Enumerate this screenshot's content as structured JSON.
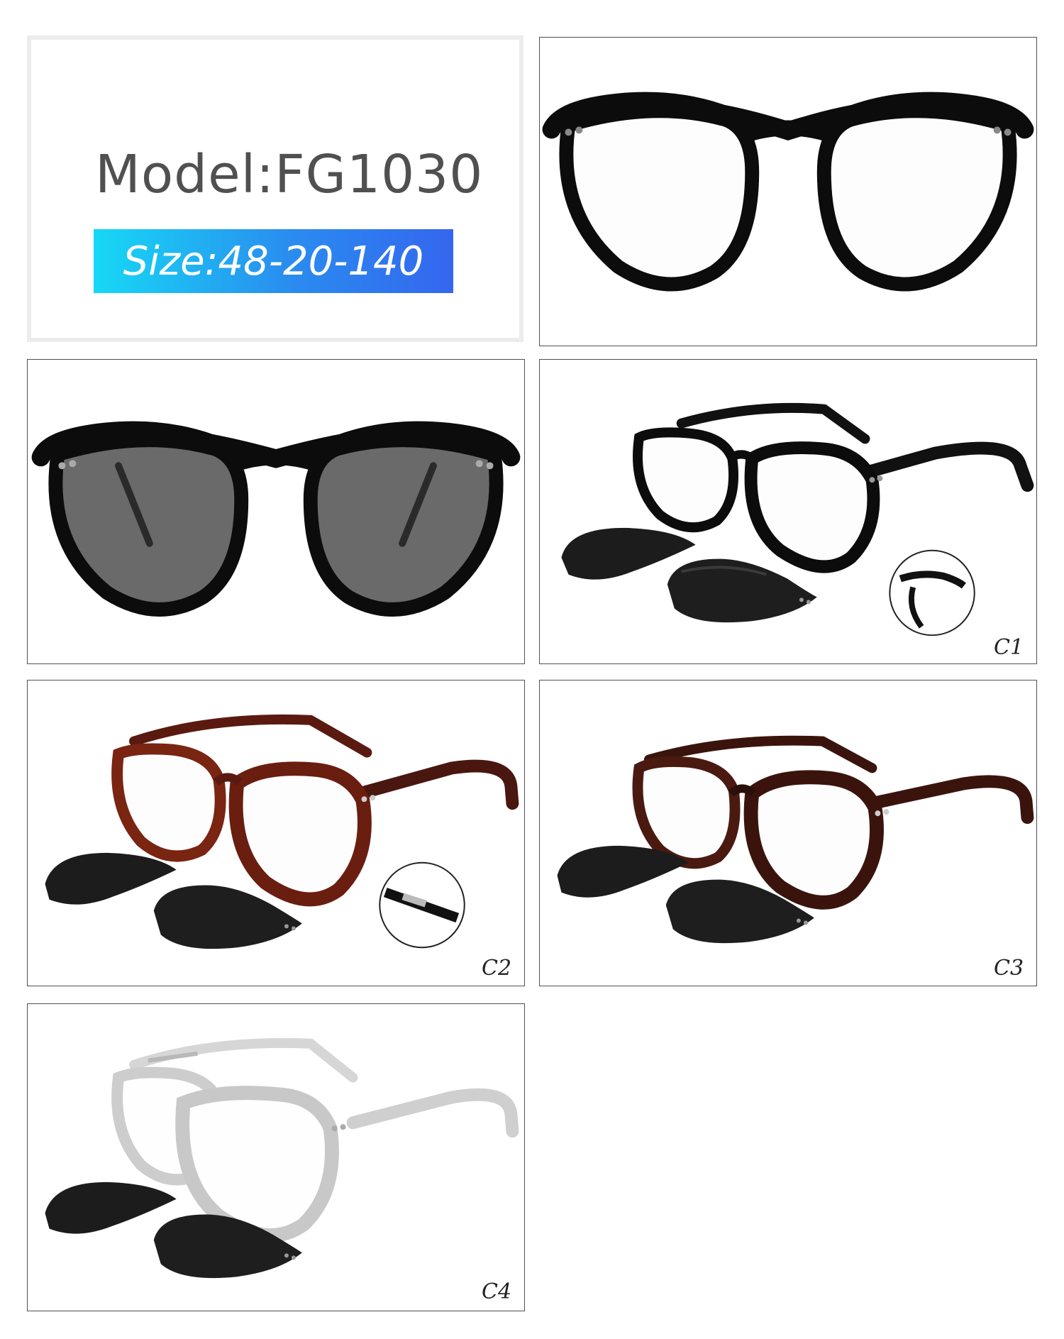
{
  "model_label": "Model:FG1030",
  "size_label": "Size:48-20-140",
  "colors": {
    "badge_start": "#16d8f5",
    "badge_end": "#3466ef",
    "model_text": "#505050"
  },
  "panels": [
    {
      "name": "front-view",
      "label": ""
    },
    {
      "name": "clip-on-front-view",
      "label": ""
    },
    {
      "name": "color-c1",
      "label": "C1"
    },
    {
      "name": "color-c2",
      "label": "C2"
    },
    {
      "name": "color-c3",
      "label": "C3"
    },
    {
      "name": "color-c4",
      "label": "C4"
    }
  ]
}
